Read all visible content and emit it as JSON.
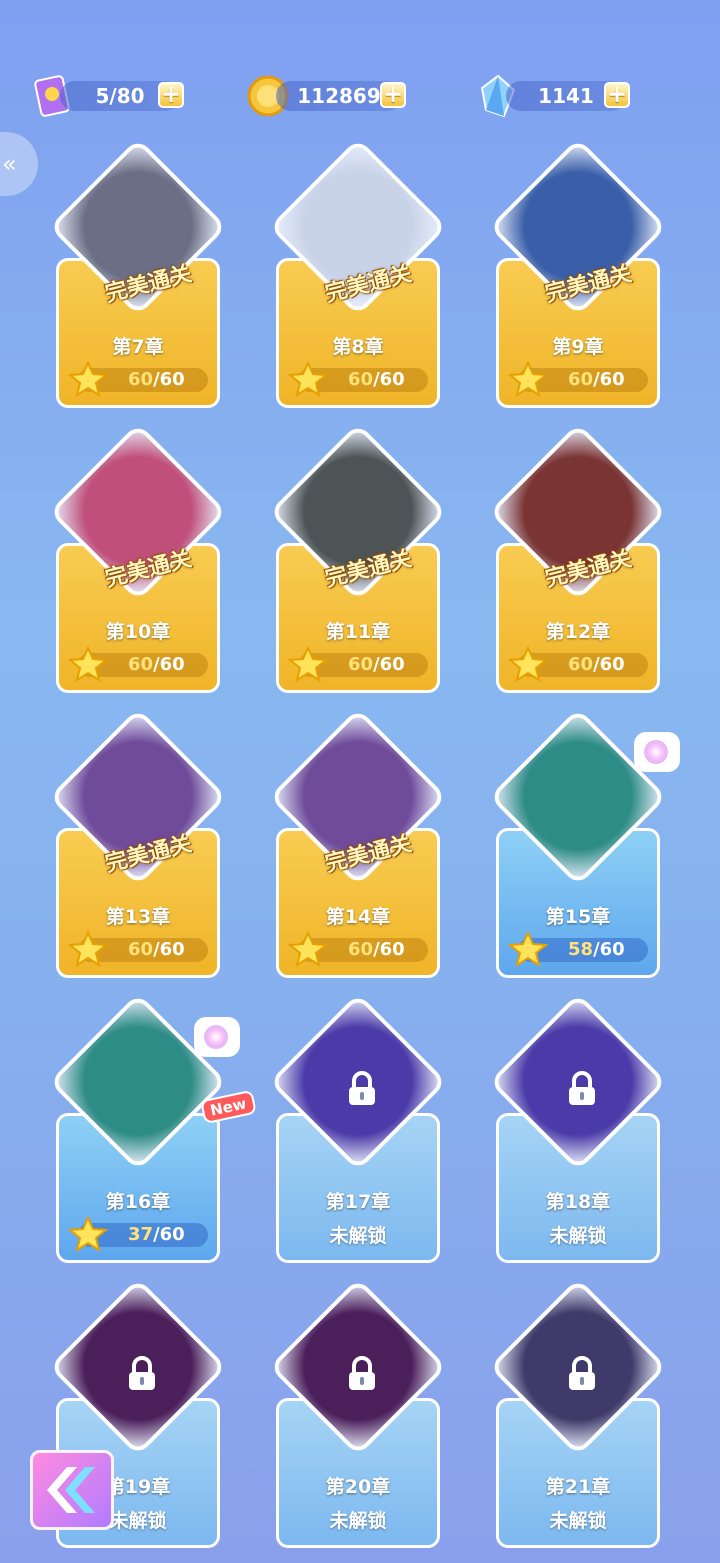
{
  "resources": {
    "stamina": {
      "value": "5/80",
      "icon": "stamina-card-icon"
    },
    "coins": {
      "value": "112869",
      "icon": "coin-icon"
    },
    "gems": {
      "value": "1141",
      "icon": "crystal-icon"
    },
    "plus_label": "+"
  },
  "side_toggle_label": "«",
  "chapters": [
    {
      "label": "第7章",
      "stars": "60",
      "max": "/60",
      "perfect": "完美通关",
      "theme": "gold"
    },
    {
      "label": "第8章",
      "stars": "60",
      "max": "/60",
      "perfect": "完美通关",
      "theme": "gold"
    },
    {
      "label": "第9章",
      "stars": "60",
      "max": "/60",
      "perfect": "完美通关",
      "theme": "gold"
    },
    {
      "label": "第10章",
      "stars": "60",
      "max": "/60",
      "perfect": "完美通关",
      "theme": "gold"
    },
    {
      "label": "第11章",
      "stars": "60",
      "max": "/60",
      "perfect": "完美通关",
      "theme": "gold"
    },
    {
      "label": "第12章",
      "stars": "60",
      "max": "/60",
      "perfect": "完美通关",
      "theme": "gold"
    },
    {
      "label": "第13章",
      "stars": "60",
      "max": "/60",
      "perfect": "完美通关",
      "theme": "gold"
    },
    {
      "label": "第14章",
      "stars": "60",
      "max": "/60",
      "perfect": "完美通关",
      "theme": "gold"
    },
    {
      "label": "第15章",
      "stars": "58",
      "max": "/60",
      "theme": "blue"
    },
    {
      "label": "第16章",
      "stars": "37",
      "max": "/60",
      "theme": "blue",
      "new": "New"
    },
    {
      "label": "第17章",
      "status": "未解锁",
      "theme": "locked"
    },
    {
      "label": "第18章",
      "status": "未解锁",
      "theme": "locked"
    },
    {
      "label": "第19章",
      "status": "未解锁",
      "theme": "locked"
    },
    {
      "label": "第20章",
      "status": "未解锁",
      "theme": "locked"
    },
    {
      "label": "第21章",
      "status": "未解锁",
      "theme": "locked"
    }
  ],
  "colors": {
    "gold_panel": "#f3bd32",
    "blue_panel": "#6fb6f0",
    "background": "#86a8ef"
  }
}
